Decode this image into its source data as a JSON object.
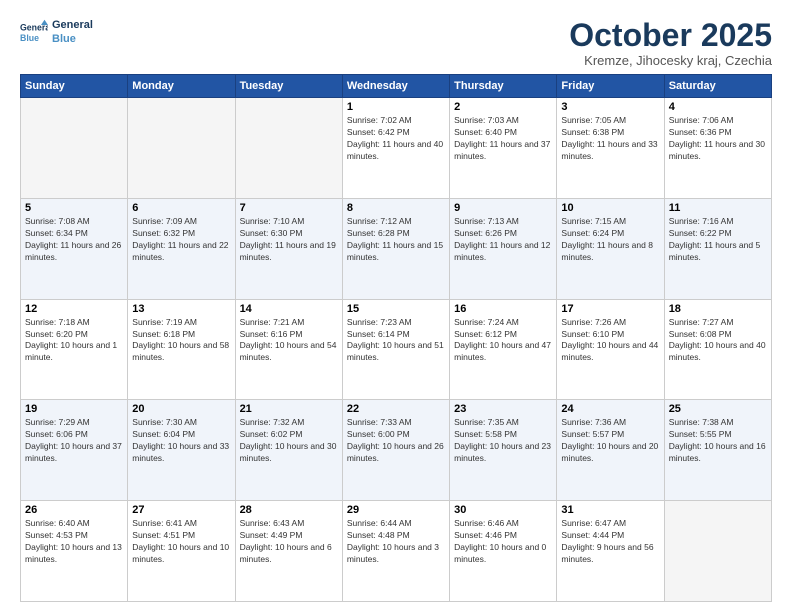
{
  "header": {
    "logo_line1": "General",
    "logo_line2": "Blue",
    "month": "October 2025",
    "location": "Kremze, Jihocesky kraj, Czechia"
  },
  "weekdays": [
    "Sunday",
    "Monday",
    "Tuesday",
    "Wednesday",
    "Thursday",
    "Friday",
    "Saturday"
  ],
  "weeks": [
    [
      {
        "day": "",
        "empty": true
      },
      {
        "day": "",
        "empty": true
      },
      {
        "day": "",
        "empty": true
      },
      {
        "day": "1",
        "sunrise": "7:02 AM",
        "sunset": "6:42 PM",
        "daylight": "11 hours and 40 minutes."
      },
      {
        "day": "2",
        "sunrise": "7:03 AM",
        "sunset": "6:40 PM",
        "daylight": "11 hours and 37 minutes."
      },
      {
        "day": "3",
        "sunrise": "7:05 AM",
        "sunset": "6:38 PM",
        "daylight": "11 hours and 33 minutes."
      },
      {
        "day": "4",
        "sunrise": "7:06 AM",
        "sunset": "6:36 PM",
        "daylight": "11 hours and 30 minutes."
      }
    ],
    [
      {
        "day": "5",
        "sunrise": "7:08 AM",
        "sunset": "6:34 PM",
        "daylight": "11 hours and 26 minutes."
      },
      {
        "day": "6",
        "sunrise": "7:09 AM",
        "sunset": "6:32 PM",
        "daylight": "11 hours and 22 minutes."
      },
      {
        "day": "7",
        "sunrise": "7:10 AM",
        "sunset": "6:30 PM",
        "daylight": "11 hours and 19 minutes."
      },
      {
        "day": "8",
        "sunrise": "7:12 AM",
        "sunset": "6:28 PM",
        "daylight": "11 hours and 15 minutes."
      },
      {
        "day": "9",
        "sunrise": "7:13 AM",
        "sunset": "6:26 PM",
        "daylight": "11 hours and 12 minutes."
      },
      {
        "day": "10",
        "sunrise": "7:15 AM",
        "sunset": "6:24 PM",
        "daylight": "11 hours and 8 minutes."
      },
      {
        "day": "11",
        "sunrise": "7:16 AM",
        "sunset": "6:22 PM",
        "daylight": "11 hours and 5 minutes."
      }
    ],
    [
      {
        "day": "12",
        "sunrise": "7:18 AM",
        "sunset": "6:20 PM",
        "daylight": "10 hours and 1 minute."
      },
      {
        "day": "13",
        "sunrise": "7:19 AM",
        "sunset": "6:18 PM",
        "daylight": "10 hours and 58 minutes."
      },
      {
        "day": "14",
        "sunrise": "7:21 AM",
        "sunset": "6:16 PM",
        "daylight": "10 hours and 54 minutes."
      },
      {
        "day": "15",
        "sunrise": "7:23 AM",
        "sunset": "6:14 PM",
        "daylight": "10 hours and 51 minutes."
      },
      {
        "day": "16",
        "sunrise": "7:24 AM",
        "sunset": "6:12 PM",
        "daylight": "10 hours and 47 minutes."
      },
      {
        "day": "17",
        "sunrise": "7:26 AM",
        "sunset": "6:10 PM",
        "daylight": "10 hours and 44 minutes."
      },
      {
        "day": "18",
        "sunrise": "7:27 AM",
        "sunset": "6:08 PM",
        "daylight": "10 hours and 40 minutes."
      }
    ],
    [
      {
        "day": "19",
        "sunrise": "7:29 AM",
        "sunset": "6:06 PM",
        "daylight": "10 hours and 37 minutes."
      },
      {
        "day": "20",
        "sunrise": "7:30 AM",
        "sunset": "6:04 PM",
        "daylight": "10 hours and 33 minutes."
      },
      {
        "day": "21",
        "sunrise": "7:32 AM",
        "sunset": "6:02 PM",
        "daylight": "10 hours and 30 minutes."
      },
      {
        "day": "22",
        "sunrise": "7:33 AM",
        "sunset": "6:00 PM",
        "daylight": "10 hours and 26 minutes."
      },
      {
        "day": "23",
        "sunrise": "7:35 AM",
        "sunset": "5:58 PM",
        "daylight": "10 hours and 23 minutes."
      },
      {
        "day": "24",
        "sunrise": "7:36 AM",
        "sunset": "5:57 PM",
        "daylight": "10 hours and 20 minutes."
      },
      {
        "day": "25",
        "sunrise": "7:38 AM",
        "sunset": "5:55 PM",
        "daylight": "10 hours and 16 minutes."
      }
    ],
    [
      {
        "day": "26",
        "sunrise": "6:40 AM",
        "sunset": "4:53 PM",
        "daylight": "10 hours and 13 minutes."
      },
      {
        "day": "27",
        "sunrise": "6:41 AM",
        "sunset": "4:51 PM",
        "daylight": "10 hours and 10 minutes."
      },
      {
        "day": "28",
        "sunrise": "6:43 AM",
        "sunset": "4:49 PM",
        "daylight": "10 hours and 6 minutes."
      },
      {
        "day": "29",
        "sunrise": "6:44 AM",
        "sunset": "4:48 PM",
        "daylight": "10 hours and 3 minutes."
      },
      {
        "day": "30",
        "sunrise": "6:46 AM",
        "sunset": "4:46 PM",
        "daylight": "10 hours and 0 minutes."
      },
      {
        "day": "31",
        "sunrise": "6:47 AM",
        "sunset": "4:44 PM",
        "daylight": "9 hours and 56 minutes."
      },
      {
        "day": "",
        "empty": true
      }
    ]
  ]
}
